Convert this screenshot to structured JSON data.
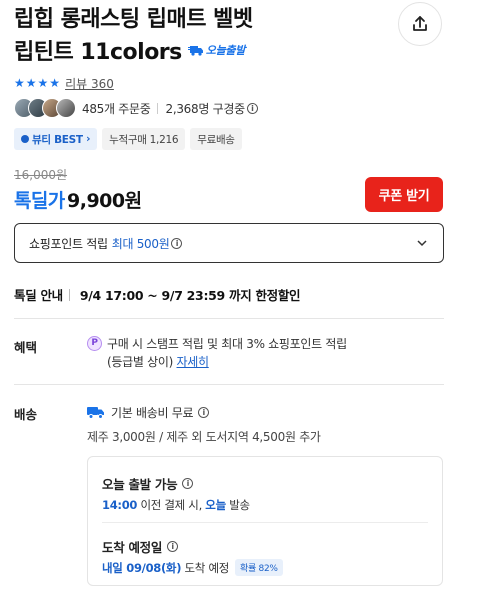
{
  "product": {
    "title_line1": "립힙 롱래스팅 립매트 벨벳",
    "title_line2": "립틴트 11colors",
    "today_ship_badge": "오늘출발"
  },
  "rating": {
    "stars": 4,
    "review_label": "리뷰 360"
  },
  "orders": {
    "order_count": "485개 주문중",
    "subscriber_count": "2,368명 구경중"
  },
  "tags": {
    "beauty": "뷰티 BEST",
    "cumulative": "누적구매 1,216",
    "free_ship": "무료배송"
  },
  "price": {
    "original": "16,000원",
    "sale_label": "톡딜가",
    "sale_price": "9,900원",
    "coupon_button": "쿠폰 받기"
  },
  "points": {
    "label": "쇼핑포인트 적립",
    "max": "최대 500원"
  },
  "deal": {
    "label": "톡딜 안내",
    "value": "9/4 17:00 ~ 9/7 23:59 까지 한정할인"
  },
  "benefit": {
    "label": "혜택",
    "badge": "P",
    "text1": "구매 시 스탬프 적립 및 최대 3% 쇼핑포인트 적립",
    "text2": "(등급별 상이)",
    "link": "자세히"
  },
  "shipping": {
    "label": "배송",
    "basic": "기본 배송비 무료",
    "extra": "제주 3,000원 / 제주 외 도서지역 4,500원 추가"
  },
  "delivery": {
    "today_label": "오늘 출발 가능",
    "today_time": "14:00",
    "today_mid": "이전 결제 시,",
    "today_word": "오늘",
    "today_end": "발송",
    "eta_label": "도착 예정일",
    "eta_date": "내일 09/08(화)",
    "eta_suffix": "도착 예정",
    "eta_prob": "확률 82%"
  },
  "colors": {
    "accent_blue": "#1a73e8",
    "coupon_red": "#e8231b"
  }
}
